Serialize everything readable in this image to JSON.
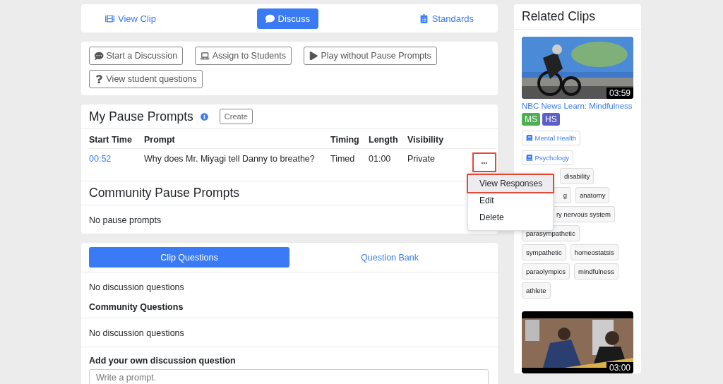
{
  "nav": [
    {
      "label": "View Clip",
      "kind": "film",
      "selected": false
    },
    {
      "label": "Discuss",
      "kind": "chat",
      "selected": true
    },
    {
      "label": "Standards",
      "kind": "clipboard",
      "selected": false
    }
  ],
  "actions": [
    {
      "label": "Start a Discussion",
      "kind": "chat"
    },
    {
      "label": "Assign to Students",
      "kind": "laptop"
    },
    {
      "label": "Play without Pause Prompts",
      "kind": "play"
    },
    {
      "label": "View student questions",
      "kind": "question"
    }
  ],
  "my_prompts": {
    "title": "My Pause Prompts",
    "create": "Create",
    "columns": [
      "Start Time",
      "Prompt",
      "Timing",
      "Length",
      "Visibility"
    ],
    "rows": [
      {
        "start": "00:52",
        "prompt": "Why does Mr. Miyagi tell Danny to breathe?",
        "timing": "Timed",
        "length": "01:00",
        "visibility": "Private",
        "menu_button": "•••",
        "menu_open": true
      }
    ]
  },
  "menu": [
    {
      "label": "View Responses",
      "selected": true
    },
    {
      "label": "Edit",
      "selected": false
    },
    {
      "label": "Delete",
      "selected": false
    }
  ],
  "community_prompts": {
    "title": "Community Pause Prompts",
    "empty": "No pause prompts"
  },
  "question_tabs": [
    {
      "label": "Clip Questions",
      "selected": true
    },
    {
      "label": "Question Bank",
      "selected": false
    }
  ],
  "clip_questions_empty": "No discussion questions",
  "community_questions": {
    "title": "Community Questions",
    "empty": "No discussion questions"
  },
  "add_question": {
    "title": "Add your own discussion question",
    "placeholder": "Write a prompt."
  },
  "related": {
    "title": "Related Clips",
    "clips": [
      {
        "duration": "03:59",
        "title": "NBC News Learn: Mindfulness",
        "grades": [
          {
            "label": "MS",
            "color": "#4caf50"
          },
          {
            "label": "HS",
            "color": "#5b5fc7"
          }
        ],
        "subjects": [
          "Mental Health",
          "Psychology"
        ],
        "tag_rows": [
          [
            "",
            "disability"
          ],
          [
            "g",
            "anatomy"
          ],
          [
            "ry nervous system"
          ],
          [
            "parasympathetic"
          ],
          [
            "sympathetic",
            "homeostatsis"
          ],
          [
            "paraolympics",
            "mindfulness"
          ],
          [
            "athlete"
          ]
        ]
      },
      {
        "duration": "03:00"
      }
    ]
  }
}
